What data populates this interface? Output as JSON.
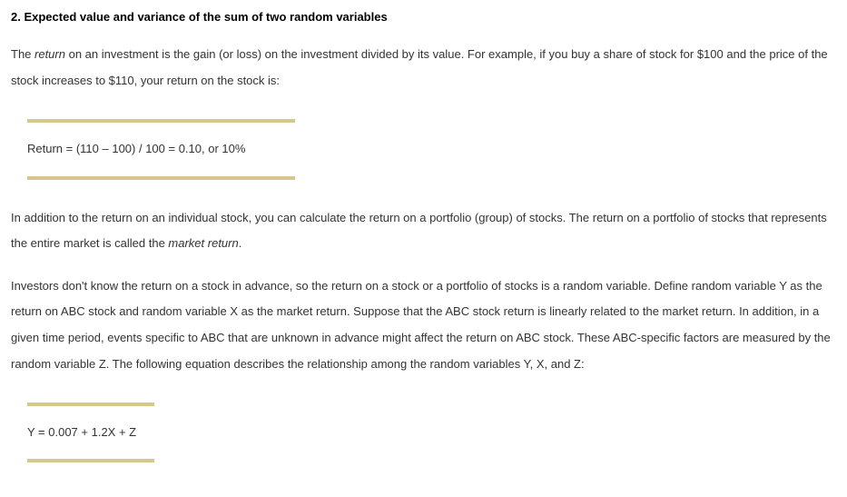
{
  "heading": "2. Expected value and variance of the sum of two random variables",
  "para1_part1": "The ",
  "para1_italic1": "return",
  "para1_part2": " on an investment is the gain (or loss) on the investment divided by its value. For example, if you buy a share of stock for $100 and the price of the stock increases to $110, your return on the stock is:",
  "formula1": "Return = (110 – 100) / 100 = 0.10, or 10%",
  "para2_part1": "In addition to the return on an individual stock, you can calculate the return on a portfolio (group) of stocks. The return on a portfolio of stocks that represents the entire market is called the ",
  "para2_italic1": "market return",
  "para2_part2": ".",
  "para3": "Investors don't know the return on a stock in advance, so the return on a stock or a portfolio of stocks is a random variable. Define random variable Y as the return on ABC stock and random variable X as the market return. Suppose that the ABC stock return is linearly related to the market return. In addition, in a given time period, events specific to ABC that are unknown in advance might affect the return on ABC stock. These ABC-specific factors are measured by the random variable Z. The following equation describes the relationship among the random variables Y, X, and Z:",
  "formula2": "Y = 0.007 + 1.2X + Z"
}
